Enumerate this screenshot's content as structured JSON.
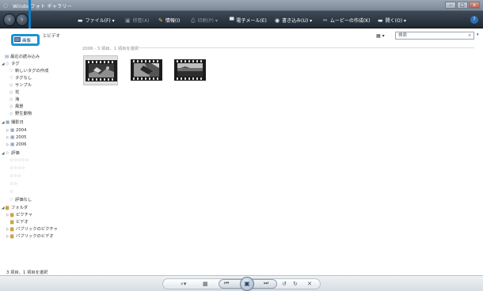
{
  "window": {
    "title": "Windows フォト ギャラリー",
    "title_visible_fragment": "フォト ギャラリー",
    "title_prefix": "Windo"
  },
  "toolbar": {
    "file": "ファイル(F) ▾",
    "fix": "修整(A)",
    "info": "情報(I)",
    "print": "印刷(P) ▾",
    "email": "電子メール(E)",
    "burn": "書き込み(U) ▾",
    "movie": "ムービーの作成(K)",
    "open": "開く(O) ▾",
    "help": "?"
  },
  "sidebar": {
    "view_label": "画像",
    "video_label": "とビデオ",
    "recent": "最近の読み込み",
    "tags": "タグ",
    "tag_items": [
      "新しいタグの作成",
      "タグなし",
      "サンプル",
      "花",
      "海",
      "風景",
      "野生動物"
    ],
    "date_taken": "撮影日",
    "years": [
      "2004",
      "2005",
      "2006"
    ],
    "rating": "評価",
    "rating_stars": [
      "☆☆☆☆☆",
      "☆☆☆☆",
      "☆☆☆",
      "☆☆",
      "☆"
    ],
    "no_rating": "評価なし",
    "folder": "フォルダ",
    "folder_items": [
      "ピクチャ",
      "ビデオ",
      "パブリックのピクチャ",
      "パブリックのビデオ"
    ]
  },
  "main": {
    "search_placeholder": "検索",
    "group_header": "2006 - 3 項目、1 項目を選択",
    "thumbnails": [
      {
        "selected": true
      },
      {
        "selected": false
      },
      {
        "selected": false
      }
    ]
  },
  "status": {
    "text": "3 項目、1 項目を選択"
  },
  "accent_color": "#1a93d6"
}
